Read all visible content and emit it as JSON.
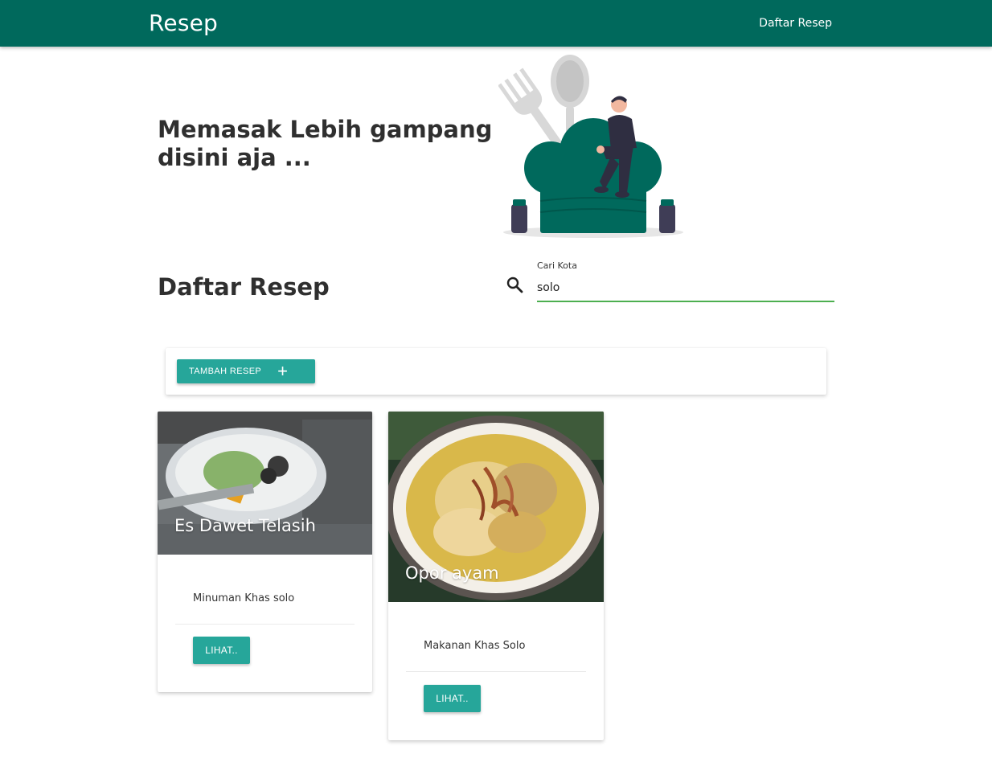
{
  "navbar": {
    "brand": "Resep",
    "link": "Daftar Resep"
  },
  "hero": {
    "title": "Memasak Lebih gampang disini aja ..."
  },
  "section": {
    "title": "Daftar Resep"
  },
  "search": {
    "label": "Cari Kota",
    "value": "solo",
    "icon": "search-icon"
  },
  "toolbar": {
    "add_label": "TAMBAH RESEP",
    "add_icon": "plus-icon"
  },
  "recipes": [
    {
      "title": "Es Dawet Telasih",
      "description": "Minuman Khas solo",
      "button": "LIHAT.."
    },
    {
      "title": "Opor ayam",
      "description": "Makanan Khas Solo",
      "button": "LIHAT.."
    }
  ],
  "colors": {
    "primary": "#00695c",
    "accent": "#26a69a",
    "underline": "#4caf50"
  }
}
